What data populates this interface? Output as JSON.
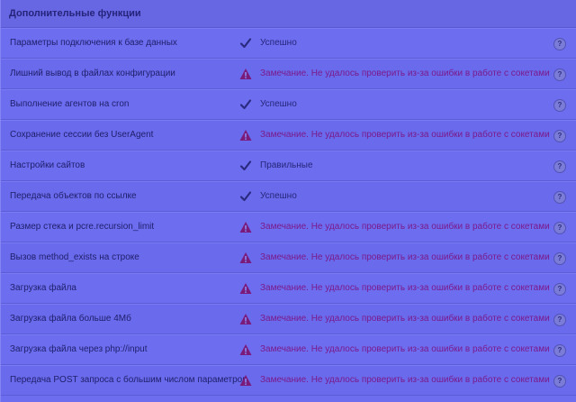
{
  "section": {
    "title": "Дополнительные функции"
  },
  "help_label": "?",
  "rows": [
    {
      "name": "Параметры подключения к базе данных",
      "status": "ok",
      "icon": "check-icon",
      "text": "Успешно"
    },
    {
      "name": "Лишний вывод в файлах конфигурации",
      "status": "warn",
      "icon": "warning-icon",
      "text": "Замечание. Не удалось проверить из-за ошибки в работе с сокетами"
    },
    {
      "name": "Выполнение агентов на cron",
      "status": "ok",
      "icon": "check-icon",
      "text": "Успешно"
    },
    {
      "name": "Сохранение сессии без UserAgent",
      "status": "warn",
      "icon": "warning-icon",
      "text": "Замечание. Не удалось проверить из-за ошибки в работе с сокетами"
    },
    {
      "name": "Настройки сайтов",
      "status": "ok",
      "icon": "check-icon",
      "text": "Правильные"
    },
    {
      "name": "Передача объектов по ссылке",
      "status": "ok",
      "icon": "check-icon",
      "text": "Успешно"
    },
    {
      "name": "Размер стека и pcre.recursion_limit",
      "status": "warn",
      "icon": "warning-icon",
      "text": "Замечание. Не удалось проверить из-за ошибки в работе с сокетами"
    },
    {
      "name": "Вызов method_exists на строке",
      "status": "warn",
      "icon": "warning-icon",
      "text": "Замечание. Не удалось проверить из-за ошибки в работе с сокетами"
    },
    {
      "name": "Загрузка файла",
      "status": "warn",
      "icon": "warning-icon",
      "text": "Замечание. Не удалось проверить из-за ошибки в работе с сокетами"
    },
    {
      "name": "Загрузка файла больше 4Мб",
      "status": "warn",
      "icon": "warning-icon",
      "text": "Замечание. Не удалось проверить из-за ошибки в работе с сокетами"
    },
    {
      "name": "Загрузка файла через php://input",
      "status": "warn",
      "icon": "warning-icon",
      "text": "Замечание. Не удалось проверить из-за ошибки в работе с сокетами"
    },
    {
      "name": "Передача POST запроса с большим числом параметров",
      "status": "warn",
      "icon": "warning-icon",
      "text": "Замечание. Не удалось проверить из-за ошибки в работе с сокетами"
    }
  ],
  "colors": {
    "check": "#2a2a80",
    "warning_fill": "#7a1a7a",
    "warning_mark": "#8a8af0"
  }
}
